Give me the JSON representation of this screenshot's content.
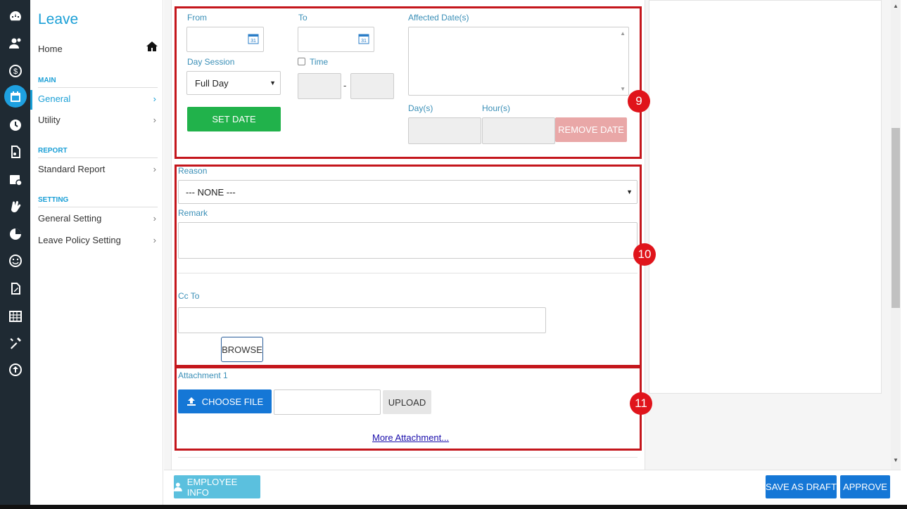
{
  "sidebar": {
    "title": "Leave",
    "home": "Home",
    "sections": {
      "main": "MAIN",
      "report": "REPORT",
      "setting": "SETTING"
    },
    "items": {
      "general": "General",
      "utility": "Utility",
      "standard_report": "Standard Report",
      "general_setting": "General Setting",
      "leave_policy_setting": "Leave Policy Setting"
    }
  },
  "rail_icons": [
    "dashboard-icon",
    "users-icon",
    "dollar-icon",
    "calendar-icon",
    "clock-icon",
    "document-icon",
    "calendar-check-icon",
    "hand-icon",
    "pie-chart-icon",
    "smiley-icon",
    "file-edit-icon",
    "table-icon",
    "tools-icon",
    "upload-icon"
  ],
  "date_section": {
    "from_label": "From",
    "to_label": "To",
    "affected_label": "Affected Date(s)",
    "day_session_label": "Day Session",
    "day_session_value": "Full Day",
    "time_label": "Time",
    "time_separator": "-",
    "set_date": "SET DATE",
    "days_label": "Day(s)",
    "hours_label": "Hour(s)",
    "remove_date": "REMOVE DATE",
    "badge": "9"
  },
  "reason_section": {
    "reason_label": "Reason",
    "reason_value": "--- NONE ---",
    "remark_label": "Remark",
    "cc_label": "Cc To",
    "browse": "BROWSE",
    "badge": "10"
  },
  "attachment_section": {
    "label": "Attachment 1",
    "choose_file": "CHOOSE FILE",
    "upload": "UPLOAD",
    "more": "More Attachment...",
    "badge": "11"
  },
  "footer": {
    "employee_info": "EMPLOYEE INFO",
    "save_draft": "SAVE AS DRAFT",
    "approve": "APPROVE"
  },
  "colors": {
    "rail_bg": "#1f2a33",
    "accent": "#1a9fd6",
    "green": "#21b24b",
    "primary": "#1577d6",
    "remove_btn": "#e9a7a7",
    "highlight_box": "#c4161c"
  }
}
